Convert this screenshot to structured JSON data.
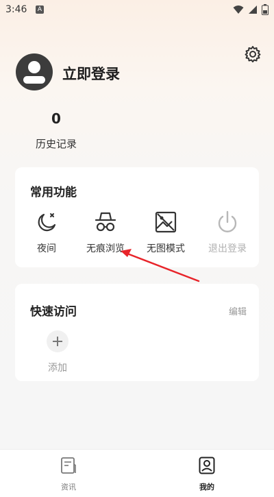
{
  "status_bar": {
    "time": "3:46",
    "app_badge": "A"
  },
  "profile": {
    "login_text": "立即登录",
    "history_count": "0",
    "history_label": "历史记录"
  },
  "common_functions": {
    "title": "常用功能",
    "items": [
      {
        "label": "夜间",
        "icon": "night-mode-icon"
      },
      {
        "label": "无痕浏览",
        "icon": "incognito-icon"
      },
      {
        "label": "无图模式",
        "icon": "no-image-icon"
      },
      {
        "label": "退出登录",
        "icon": "power-icon",
        "disabled": true
      }
    ]
  },
  "quick_access": {
    "title": "快速访问",
    "edit_label": "编辑",
    "add_label": "添加"
  },
  "bottom_nav": {
    "items": [
      {
        "label": "资讯",
        "icon": "news-icon"
      },
      {
        "label": "我的",
        "icon": "profile-icon",
        "active": true
      }
    ]
  },
  "colors": {
    "annotation_arrow": "#e8242a",
    "accent_text": "#222222",
    "disabled": "#b0b0b0"
  }
}
